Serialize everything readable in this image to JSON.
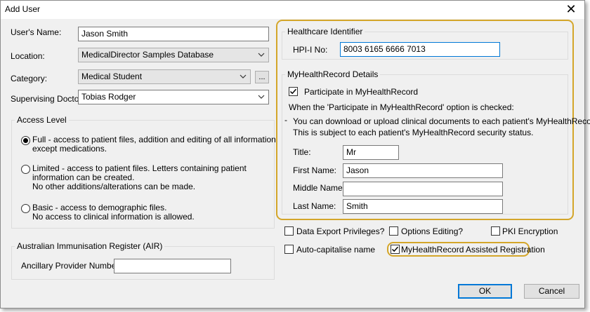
{
  "window": {
    "title": "Add User",
    "close_glyph": "✕"
  },
  "left": {
    "users_name_label": "User's Name:",
    "users_name_value": "Jason Smith",
    "location_label": "Location:",
    "location_value": "MedicalDirector Samples Database",
    "category_label": "Category:",
    "category_value": "Medical Student",
    "category_more": "...",
    "supervising_label": "Supervising Doctor:",
    "supervising_value": "Tobias Rodger"
  },
  "access": {
    "title": "Access Level",
    "options": [
      {
        "line1": "Full - access to patient files, addition and editing of all information",
        "line2": "except medications.",
        "line3": "",
        "selected": true
      },
      {
        "line1": "Limited - access to patient files.  Letters containing patient",
        "line2": "information can be created.",
        "line3": "No other additions/alterations can be made.",
        "selected": false
      },
      {
        "line1": "Basic - access to demographic files.",
        "line2": "No access to clinical information is allowed.",
        "line3": "",
        "selected": false
      }
    ]
  },
  "air": {
    "title": "Australian Immunisation Register (AIR)",
    "ancillary_label": "Ancillary Provider Number:",
    "ancillary_value": ""
  },
  "healthcare": {
    "title": "Healthcare Identifier",
    "hpii_label": "HPI-I No:",
    "hpii_value": "8003 6165 6666 7013"
  },
  "mhr": {
    "title": "MyHealthRecord Details",
    "participate_label": "Participate in MyHealthRecord",
    "participate_checked": true,
    "note": "When the 'Participate in MyHealthRecord' option is checked:",
    "bullet": "-",
    "info_line1": "You can download or upload clinical documents to each patient's MyHealthRecord.",
    "info_line2": "This is subject to each patient's MyHealthRecord security status.",
    "title_label": "Title:",
    "title_value": "Mr",
    "first_label": "First Name:",
    "first_value": "Jason",
    "middle_label": "Middle Name:",
    "middle_value": "",
    "last_label": "Last Name:",
    "last_value": "Smith"
  },
  "options": {
    "data_export": "Data Export Privileges?",
    "options_editing": "Options Editing?",
    "pki": "PKI Encryption",
    "auto_capitalise": "Auto-capitalise name",
    "assisted_registration": "MyHealthRecord Assisted Registration",
    "assisted_registration_checked": true
  },
  "buttons": {
    "ok": "OK",
    "cancel": "Cancel"
  },
  "colors": {
    "highlight": "#d4a62a",
    "focus": "#0078d7"
  },
  "icons": [
    "close-icon",
    "chevron-down-icon",
    "checkmark-icon"
  ]
}
